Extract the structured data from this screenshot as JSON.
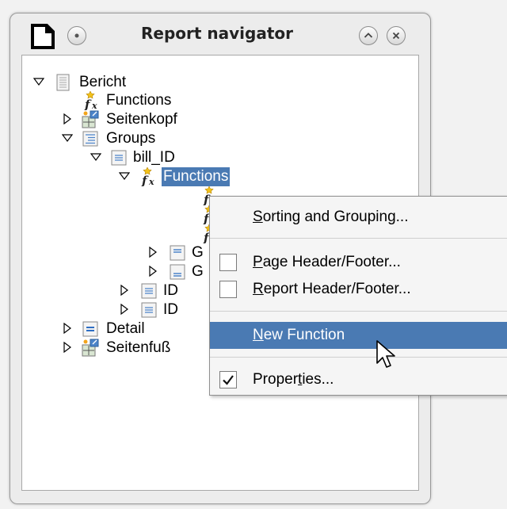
{
  "window": {
    "title": "Report navigator"
  },
  "tree": {
    "root": "Bericht",
    "functions": "Functions",
    "page_header": "Seitenkopf",
    "groups": "Groups",
    "bill_id": "bill_ID",
    "bill_functions": "Functions",
    "group_item_1": "G",
    "group_item_2": "G",
    "id_1": "ID",
    "id_2": "ID",
    "detail": "Detail",
    "page_footer": "Seitenfuß"
  },
  "context_menu": {
    "sorting_grouping": {
      "mnemonic": "S",
      "rest": "orting and Grouping..."
    },
    "page_header_footer": {
      "mnemonic": "P",
      "rest": "age Header/Footer...",
      "checked": false
    },
    "report_header_footer": {
      "mnemonic": "R",
      "rest": "eport Header/Footer...",
      "checked": false
    },
    "new_function": {
      "mnemonic": "N",
      "rest": "ew Function"
    },
    "properties": {
      "before": "Proper",
      "mnemonic": "t",
      "after": "ies...",
      "checked": true
    }
  },
  "colors": {
    "selection": "#4a7ab3",
    "window_bg": "#ececec"
  }
}
